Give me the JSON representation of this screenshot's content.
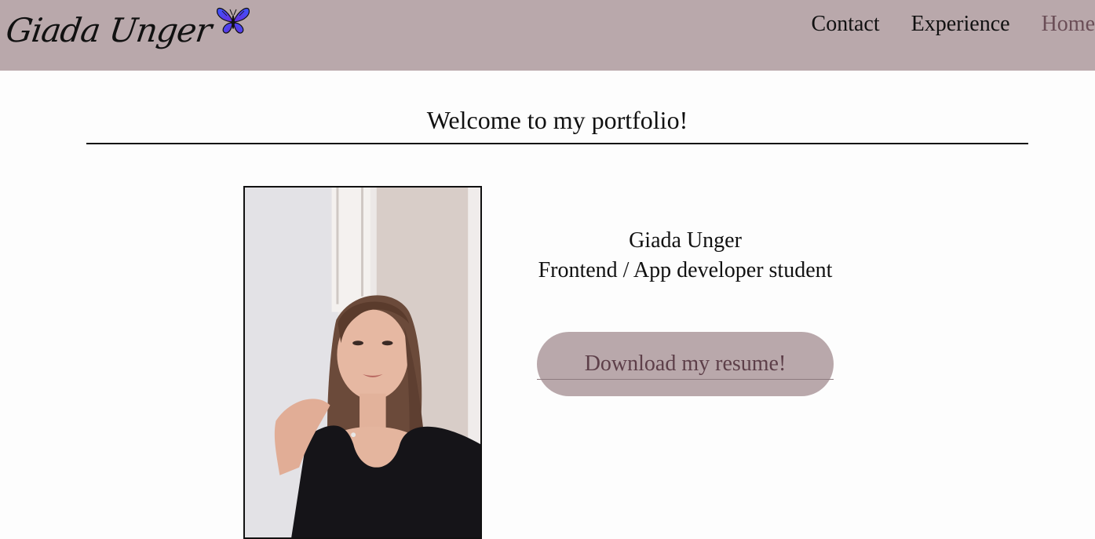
{
  "header": {
    "logo_text": "Giada Unger",
    "logo_icon": "butterfly-icon",
    "nav": [
      {
        "label": "Contact"
      },
      {
        "label": "Experience"
      },
      {
        "label": "Home",
        "active": true
      }
    ]
  },
  "main": {
    "welcome_title": "Welcome to my portfolio!",
    "photo_description_icon": "profile-photo",
    "name": "Giada Unger",
    "role": "Frontend / App developer student",
    "download_label": "Download my resume!"
  },
  "colors": {
    "header_bg": "#b9a8ab",
    "button_bg": "#b9a8ab",
    "button_text": "#5d3f49",
    "active_nav": "#6b4e57",
    "page_bg": "#fdfdfd"
  }
}
